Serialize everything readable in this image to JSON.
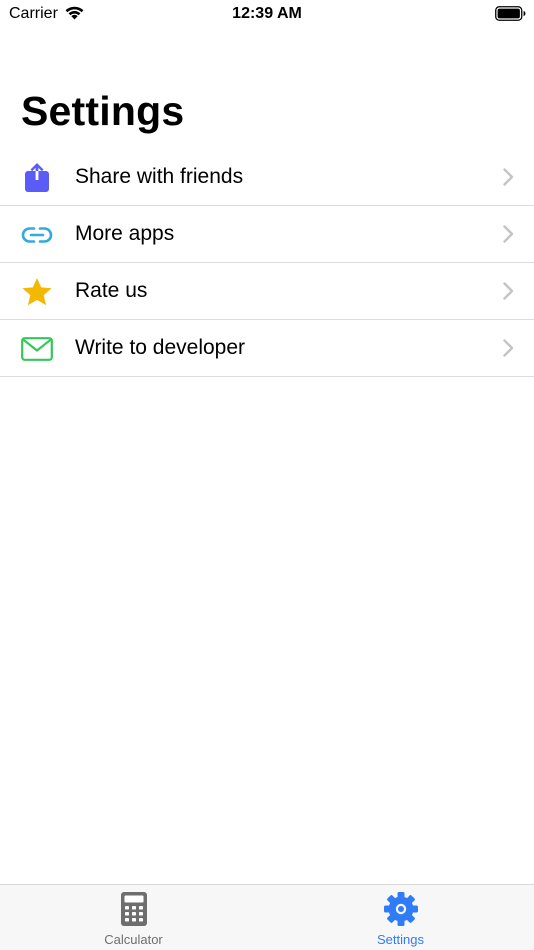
{
  "status_bar": {
    "carrier": "Carrier",
    "time": "12:39 AM",
    "icons": [
      "wifi-icon",
      "battery-icon"
    ]
  },
  "header": {
    "title": "Settings"
  },
  "settings": {
    "items": [
      {
        "label": "Share with friends",
        "icon": "share-icon",
        "color": "#5b5bf5"
      },
      {
        "label": "More apps",
        "icon": "link-icon",
        "color": "#34aadc"
      },
      {
        "label": "Rate us",
        "icon": "star-icon",
        "color": "#f5b800"
      },
      {
        "label": "Write to developer",
        "icon": "mail-icon",
        "color": "#34c759"
      }
    ]
  },
  "tab_bar": {
    "tabs": [
      {
        "label": "Calculator",
        "icon": "calculator-icon",
        "selected": false
      },
      {
        "label": "Settings",
        "icon": "gear-icon",
        "selected": true
      }
    ],
    "active_color": "#2f7cf6",
    "inactive_color": "#6e6e6e"
  }
}
